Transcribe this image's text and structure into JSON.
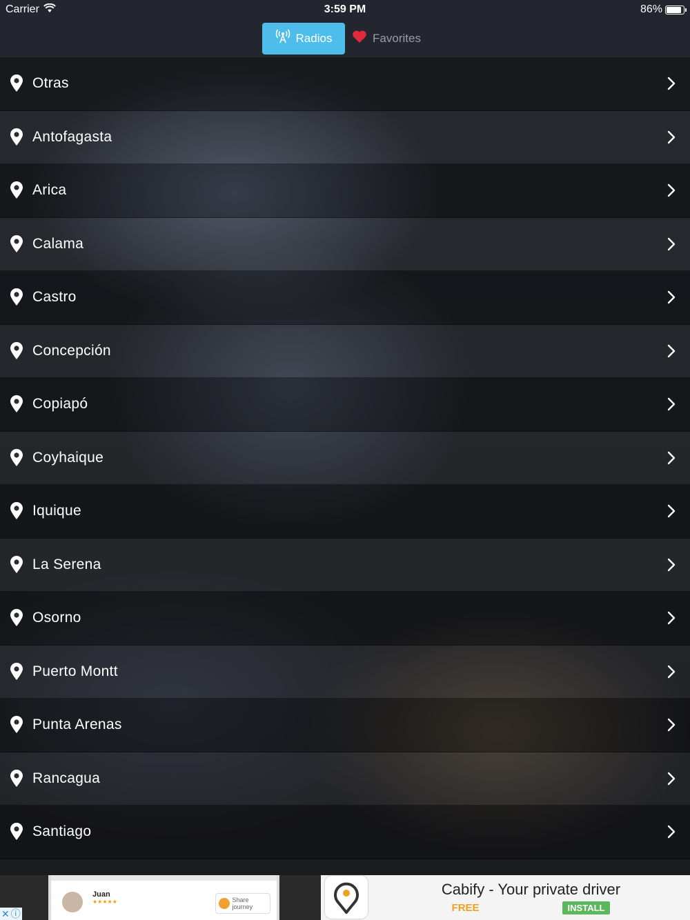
{
  "status_bar": {
    "carrier": "Carrier",
    "time": "3:59 PM",
    "battery": "86%",
    "battery_level": 0.86
  },
  "tabs": {
    "radios": "Radios",
    "favorites": "Favorites"
  },
  "cities": [
    "Otras",
    "Antofagasta",
    "Arica",
    "Calama",
    "Castro",
    "Concepción",
    "Copiapó",
    "Coyhaique",
    "Iquique",
    "La Serena",
    "Osorno",
    "Puerto Montt",
    "Punta Arenas",
    "Rancagua",
    "Santiago"
  ],
  "ad": {
    "title": "Cabify - Your private driver",
    "price": "FREE",
    "cta": "INSTALL",
    "driver_name": "Juan",
    "share_label": "Share journey"
  },
  "colors": {
    "accent": "#4fbde9",
    "heart": "#e22b3a",
    "free": "#f0a020",
    "install": "#5cb85c"
  }
}
